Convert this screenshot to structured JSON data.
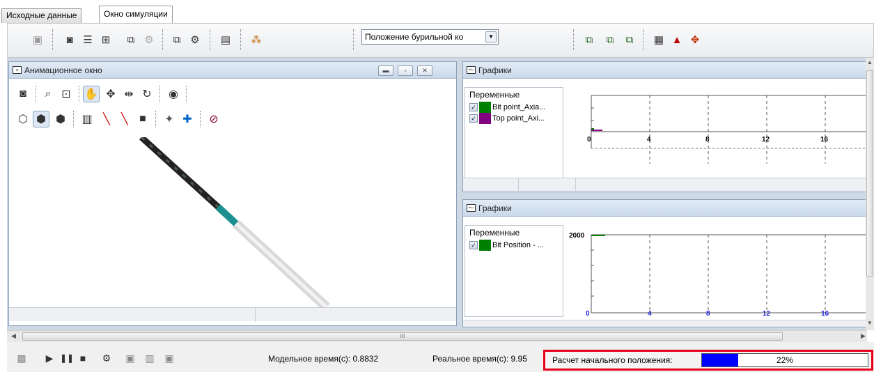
{
  "tabs": [
    {
      "label": "Исходные данные",
      "active": false
    },
    {
      "label": "Окно симуляции",
      "active": true
    }
  ],
  "toolbar": {
    "position_combo_value": "Положение бурильной ко"
  },
  "animation_window": {
    "title": "Анимационное окно"
  },
  "graphs_top": {
    "title": "Графики",
    "variables_header": "Переменные",
    "variables": [
      {
        "label": "Bit point_Axia...",
        "color": "#008000",
        "checked": true
      },
      {
        "label": "Top point_Axi...",
        "color": "#800080",
        "checked": true
      }
    ],
    "x_ticks": [
      "0",
      "4",
      "8",
      "12",
      "16"
    ]
  },
  "graphs_bottom": {
    "title": "Графики",
    "variables_header": "Переменные",
    "variables": [
      {
        "label": "Bit Position - ...",
        "color": "#008000",
        "checked": true
      }
    ],
    "y_top_label": "2000",
    "x_ticks": [
      "0",
      "4",
      "8",
      "12",
      "16"
    ]
  },
  "scrollbar_grip": "III",
  "bottom_bar": {
    "model_time": "Модельное время(с): 0.8832",
    "real_time": "Реальное время(с): 9.95",
    "progress_label": "Расчет начального положения:",
    "progress_text": "22%",
    "progress_value": 0.22,
    "accent_color": "#e8001c"
  }
}
